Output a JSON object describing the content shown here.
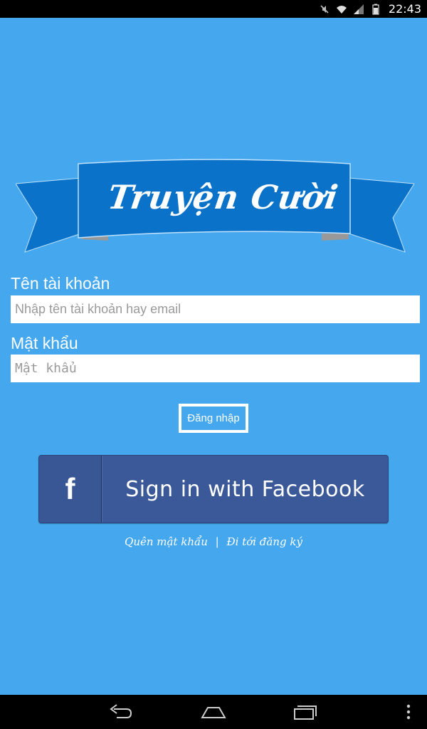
{
  "status_bar": {
    "time": "22:43",
    "icons": [
      "mute-icon",
      "wifi-icon",
      "signal-icon",
      "battery-icon"
    ]
  },
  "banner": {
    "title": "Truyện Cười",
    "ribbon_color": "#0a73c9"
  },
  "form": {
    "username_label": "Tên tài khoản",
    "username_placeholder": "Nhập tên tài khoản hay email",
    "password_label": "Mật khẩu",
    "password_placeholder": "Mật khẩu",
    "login_button": "Đăng nhập"
  },
  "facebook": {
    "icon": "f",
    "label": "Sign in with Facebook",
    "color": "#3b5998"
  },
  "links": {
    "forgot_password": "Quên mật khẩu",
    "separator": "|",
    "register": "Đi tới đăng ký"
  },
  "nav_bar": {
    "icons": [
      "back-icon",
      "home-icon",
      "recent-apps-icon",
      "menu-icon"
    ]
  },
  "colors": {
    "background": "#45a8ee",
    "bars": "#000000"
  }
}
